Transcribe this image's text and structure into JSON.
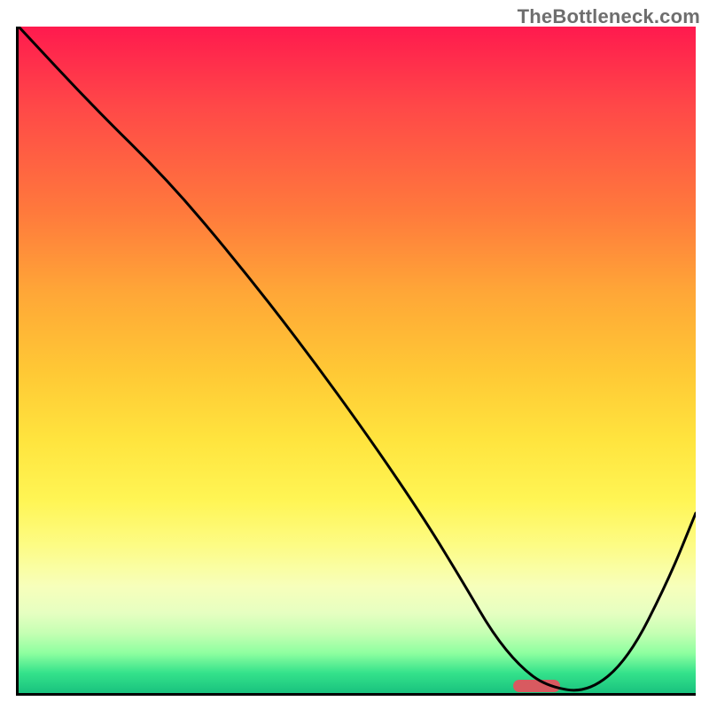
{
  "watermark": "TheBottleneck.com",
  "chart_data": {
    "type": "line",
    "title": "",
    "xlabel": "",
    "ylabel": "",
    "xlim": [
      0,
      100
    ],
    "ylim": [
      0,
      100
    ],
    "grid": false,
    "legend": false,
    "background_gradient": {
      "stops": [
        {
          "pos": 0,
          "color": "#ff1a4e"
        },
        {
          "pos": 12,
          "color": "#ff4848"
        },
        {
          "pos": 28,
          "color": "#ff7a3c"
        },
        {
          "pos": 40,
          "color": "#ffa737"
        },
        {
          "pos": 52,
          "color": "#ffc935"
        },
        {
          "pos": 62,
          "color": "#ffe43e"
        },
        {
          "pos": 71,
          "color": "#fff554"
        },
        {
          "pos": 78,
          "color": "#fdfc86"
        },
        {
          "pos": 84,
          "color": "#f7ffbb"
        },
        {
          "pos": 88,
          "color": "#e6ffc1"
        },
        {
          "pos": 91,
          "color": "#c5ffb3"
        },
        {
          "pos": 94,
          "color": "#8effa0"
        },
        {
          "pos": 97,
          "color": "#34e28b"
        },
        {
          "pos": 100,
          "color": "#19c27e"
        }
      ]
    },
    "series": [
      {
        "name": "bottleneck-curve",
        "color": "#000000",
        "x": [
          0,
          11,
          22,
          32,
          42,
          52,
          60,
          66,
          70,
          74,
          78,
          84,
          90,
          96,
          100
        ],
        "y": [
          100,
          88,
          77,
          65,
          52,
          38,
          26,
          16,
          9,
          4,
          1,
          0,
          5,
          17,
          27
        ]
      }
    ],
    "marker": {
      "name": "optimum-range",
      "color": "#d85a60",
      "x_start": 73,
      "x_end": 80,
      "y": 0
    },
    "axes_visible": {
      "left": true,
      "bottom": true,
      "ticks": false,
      "tick_labels": false
    }
  }
}
